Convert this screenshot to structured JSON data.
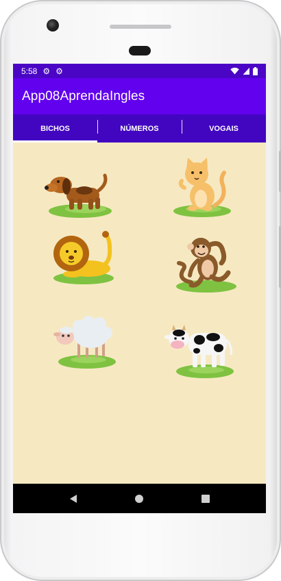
{
  "status_bar": {
    "time": "5:58",
    "left_icons": [
      "gear-icon",
      "gear-icon"
    ],
    "right_icons": [
      "wifi-icon",
      "signal-icon",
      "battery-icon"
    ]
  },
  "app_bar": {
    "title": "App08AprendaIngles"
  },
  "tabs": [
    {
      "label": "BICHOS",
      "active": true
    },
    {
      "label": "NÚMEROS",
      "active": false
    },
    {
      "label": "VOGAIS",
      "active": false
    }
  ],
  "animals": [
    {
      "name": "dog-image"
    },
    {
      "name": "cat-image"
    },
    {
      "name": "lion-image"
    },
    {
      "name": "monkey-image"
    },
    {
      "name": "sheep-image"
    },
    {
      "name": "cow-image"
    }
  ],
  "nav_bar": {
    "buttons": [
      "back-icon",
      "home-icon",
      "recents-icon"
    ]
  },
  "colors": {
    "status_bar": "#4a06c4",
    "app_bar": "#6201ed",
    "tab_bar": "#4206c0",
    "content_background": "#f6e9c2"
  }
}
